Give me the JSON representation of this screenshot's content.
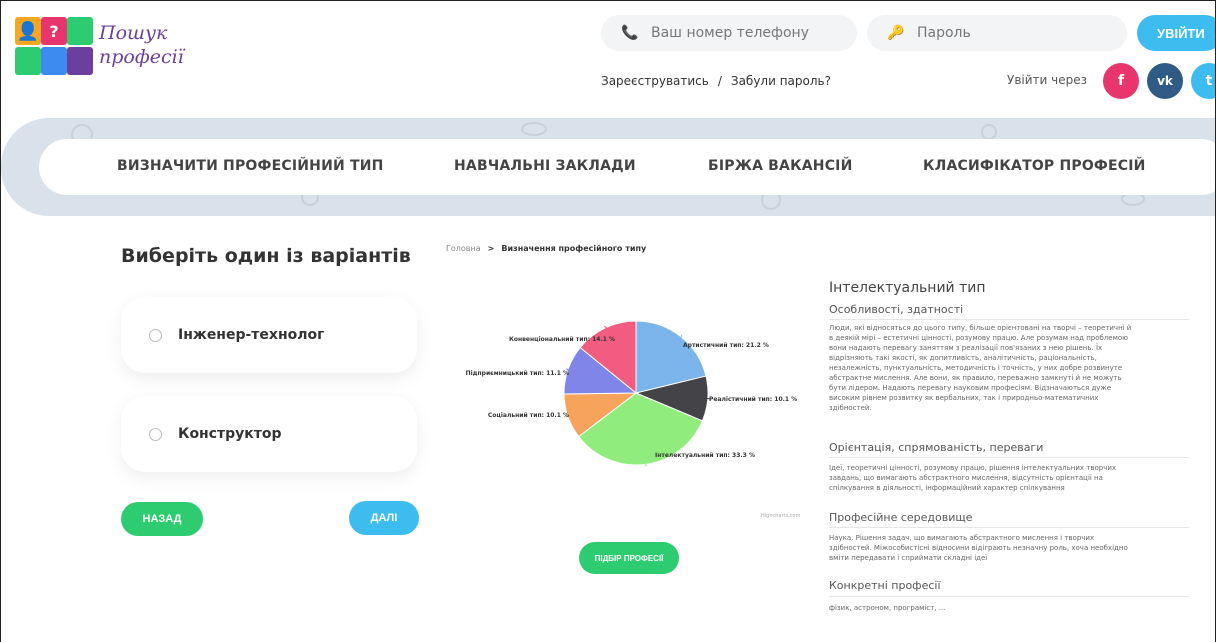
{
  "header": {
    "logo_line1": "Пошук",
    "logo_line2": "професії",
    "phone_placeholder": "Ваш номер телефону",
    "password_placeholder": "Пароль",
    "login_button": "УВІЙТИ",
    "register_link": "Зареєструватись",
    "link_separator": "/",
    "forgot_link": "Забули пароль?",
    "enter_via": "Увійти через",
    "social": [
      {
        "icon": "facebook-icon",
        "glyph": "f",
        "color": "#e8356d"
      },
      {
        "icon": "vk-icon",
        "glyph": "vk",
        "color": "#2f5b84"
      },
      {
        "icon": "twitter-icon",
        "glyph": "t",
        "color": "#3dbcf0"
      }
    ]
  },
  "nav": {
    "items": [
      "ВИЗНАЧИТИ ПРОФЕСІЙНИЙ ТИП",
      "НАВЧАЛЬНІ ЗАКЛАДИ",
      "БІРЖА ВАКАНСІЙ",
      "КЛАСИФІКАТОР ПРОФЕСІЙ"
    ]
  },
  "left": {
    "title": "Виберіть один із варіантів",
    "options": [
      "Інженер-технолог",
      "Конструктор"
    ],
    "back_button": "НАЗАД",
    "next_button": "ДАЛІ"
  },
  "breadcrumb": {
    "home": "Головна",
    "arrow": ">",
    "current": "Визначення професійного типу"
  },
  "chart_data": {
    "type": "pie",
    "slices": [
      {
        "label": "Артистичний тип: 21.2 %",
        "value": 21.2,
        "color": "#7cb5ec"
      },
      {
        "label": "Реалістичний тип: 10.1 %",
        "value": 10.1,
        "color": "#434348"
      },
      {
        "label": "Інтелектуальний тип: 33.3 %",
        "value": 33.3,
        "color": "#90ed7d"
      },
      {
        "label": "Соціальний тип: 10.1 %",
        "value": 10.1,
        "color": "#f7a35c"
      },
      {
        "label": "Підприємницький тип: 11.1 %",
        "value": 11.1,
        "color": "#8085e9"
      },
      {
        "label": "Конвенціональний тип: 14.1 %",
        "value": 14.1,
        "color": "#f15c80"
      }
    ],
    "credit": "Highcharts.com"
  },
  "select_button": "ПІДБІР ПРОФЕСІЇ",
  "right": {
    "title": "Інтелектуальний тип",
    "sections": [
      {
        "heading": "Особливості, здатності",
        "text": [
          "Люди, які відносяться до цього типу, більше орієнтовані на творчі – теоретичні й",
          "в деякій мірі – естетичні цінності, розумову працю. Але розумам над проблемою",
          "вони надають перевагу заняттям з реалізації пов'язаних з нею рішень. Їх",
          "відрізняють такі якості, як допитливість, аналітичність, раціональність,",
          "незалежність, пунктуальність, методичність і точність, у них добре розвинуте",
          "абстрактне мислення. Але вони, як правило, переважно замкнуті й не можуть",
          "бути лідером. Надають перевагу науковим професіям. Відзначаються дуже",
          "високим рівнем розвитку як вербальних, так і природньо-математичних",
          "здібностей."
        ]
      },
      {
        "heading": "Орієнтація, спрямованість, переваги",
        "text": [
          "Ідеї, теоретичні цінності, розумову працю, рішення інтелектуальних творчих",
          "завдань, що вимагають абстрактного мислення, відсутність орієнтації на",
          "спілкування в діяльності, інформаційний характер спілкування"
        ]
      },
      {
        "heading": "Професійне середовище",
        "text": [
          "Наука. Рішення задач, що вимагають абстрактного мислення і творчих",
          "здібностей. Міжособистісні відносини відіграють незначну роль, хоча необхідно",
          "вміти передавати і сприймати складні ідеї"
        ]
      },
      {
        "heading": "Конкретні професії",
        "text": [
          "фізик, астроном, програміст, ..."
        ]
      }
    ]
  }
}
